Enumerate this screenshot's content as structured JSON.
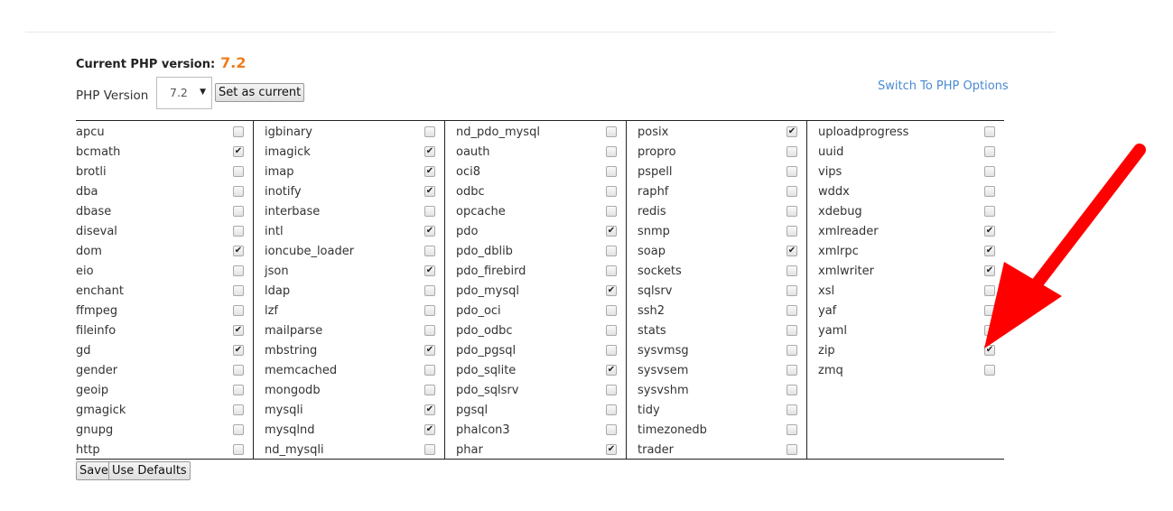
{
  "header": {
    "current_label": "Current PHP version:",
    "current_value": "7.2",
    "version_label": "PHP Version",
    "version_selected": "7.2",
    "set_current": "Set as current",
    "switch_link": "Switch To PHP Options"
  },
  "columns": [
    [
      [
        "apcu",
        0
      ],
      [
        "bcmath",
        1
      ],
      [
        "brotli",
        0
      ],
      [
        "dba",
        0
      ],
      [
        "dbase",
        0
      ],
      [
        "diseval",
        0
      ],
      [
        "dom",
        1
      ],
      [
        "eio",
        0
      ],
      [
        "enchant",
        0
      ],
      [
        "ffmpeg",
        0
      ],
      [
        "fileinfo",
        1
      ],
      [
        "gd",
        1
      ],
      [
        "gender",
        0
      ],
      [
        "geoip",
        0
      ],
      [
        "gmagick",
        0
      ],
      [
        "gnupg",
        0
      ],
      [
        "http",
        0
      ]
    ],
    [
      [
        "igbinary",
        0
      ],
      [
        "imagick",
        1
      ],
      [
        "imap",
        1
      ],
      [
        "inotify",
        1
      ],
      [
        "interbase",
        0
      ],
      [
        "intl",
        1
      ],
      [
        "ioncube_loader",
        0
      ],
      [
        "json",
        1
      ],
      [
        "ldap",
        0
      ],
      [
        "lzf",
        0
      ],
      [
        "mailparse",
        0
      ],
      [
        "mbstring",
        1
      ],
      [
        "memcached",
        0
      ],
      [
        "mongodb",
        0
      ],
      [
        "mysqli",
        1
      ],
      [
        "mysqlnd",
        1
      ],
      [
        "nd_mysqli",
        0
      ]
    ],
    [
      [
        "nd_pdo_mysql",
        0
      ],
      [
        "oauth",
        0
      ],
      [
        "oci8",
        0
      ],
      [
        "odbc",
        0
      ],
      [
        "opcache",
        0
      ],
      [
        "pdo",
        1
      ],
      [
        "pdo_dblib",
        0
      ],
      [
        "pdo_firebird",
        0
      ],
      [
        "pdo_mysql",
        1
      ],
      [
        "pdo_oci",
        0
      ],
      [
        "pdo_odbc",
        0
      ],
      [
        "pdo_pgsql",
        0
      ],
      [
        "pdo_sqlite",
        1
      ],
      [
        "pdo_sqlsrv",
        0
      ],
      [
        "pgsql",
        0
      ],
      [
        "phalcon3",
        0
      ],
      [
        "phar",
        1
      ]
    ],
    [
      [
        "posix",
        1
      ],
      [
        "propro",
        0
      ],
      [
        "pspell",
        0
      ],
      [
        "raphf",
        0
      ],
      [
        "redis",
        0
      ],
      [
        "snmp",
        0
      ],
      [
        "soap",
        1
      ],
      [
        "sockets",
        0
      ],
      [
        "sqlsrv",
        0
      ],
      [
        "ssh2",
        0
      ],
      [
        "stats",
        0
      ],
      [
        "sysvmsg",
        0
      ],
      [
        "sysvsem",
        0
      ],
      [
        "sysvshm",
        0
      ],
      [
        "tidy",
        0
      ],
      [
        "timezonedb",
        0
      ],
      [
        "trader",
        0
      ]
    ],
    [
      [
        "uploadprogress",
        0
      ],
      [
        "uuid",
        0
      ],
      [
        "vips",
        0
      ],
      [
        "wddx",
        0
      ],
      [
        "xdebug",
        0
      ],
      [
        "xmlreader",
        1
      ],
      [
        "xmlrpc",
        1
      ],
      [
        "xmlwriter",
        1
      ],
      [
        "xsl",
        0
      ],
      [
        "yaf",
        0
      ],
      [
        "yaml",
        0
      ],
      [
        "zip",
        1
      ],
      [
        "zmq",
        0
      ]
    ]
  ],
  "footer": {
    "save": "Save",
    "defaults": "Use Defaults"
  },
  "colors": {
    "accent": "#f07c1c",
    "link": "#4a8ad0",
    "arrow": "#ff0000"
  }
}
